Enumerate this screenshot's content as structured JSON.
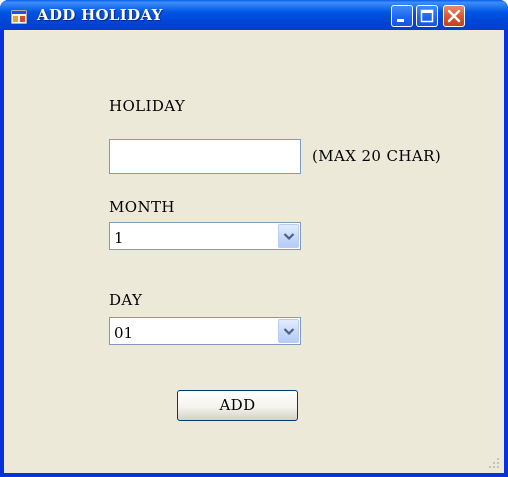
{
  "window": {
    "title": "ADD HOLIDAY",
    "controls": [
      "minimize",
      "maximize",
      "close"
    ]
  },
  "form": {
    "holiday_label": "HOLIDAY",
    "holiday_value": "",
    "holiday_hint": "(MAX 20 CHAR)",
    "month_label": "MONTH",
    "month_value": "1",
    "day_label": "DAY",
    "day_value": "01",
    "add_button": "ADD"
  },
  "colors": {
    "titlebar": "#0055e5",
    "client_background": "#ece9d8",
    "close_button": "#d7562f",
    "field_border": "#7f9db9"
  },
  "icons": [
    "app-icon",
    "minimize-icon",
    "maximize-icon",
    "close-icon",
    "chevron-down-icon",
    "resize-grip-icon"
  ]
}
